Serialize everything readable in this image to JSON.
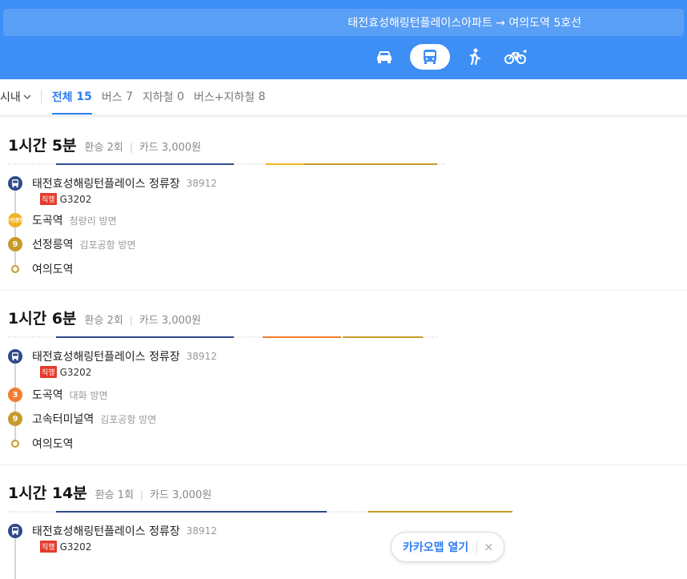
{
  "header": {
    "route_text": "태전효성해링턴플레이스아파트 → 여의도역 5호선",
    "modes": [
      "car-icon",
      "bus-icon",
      "walk-icon",
      "bike-icon"
    ],
    "active_mode": "bus-icon"
  },
  "tabs": {
    "area": "시내",
    "items": [
      {
        "label": "전체",
        "count": "15",
        "active": true
      },
      {
        "label": "버스",
        "count": "7",
        "active": false
      },
      {
        "label": "지하철",
        "count": "0",
        "active": false
      },
      {
        "label": "버스+지하철",
        "count": "8",
        "active": false
      }
    ]
  },
  "routes": [
    {
      "time_hour": "1시간",
      "time_min": "5분",
      "transfer": "환승 2회",
      "fare": "카드 3,000원",
      "stops": [
        {
          "name": "태전효성해링턴플레이스 정류장",
          "sub": "38912",
          "badge": "bus",
          "badge_color": "#2f4a8c"
        },
        {
          "name": "도곡역",
          "sub": "청량리 방면",
          "badge": "수인분당",
          "badge_color": "#f0b324"
        },
        {
          "name": "선정릉역",
          "sub": "김포공항 방면",
          "badge": "9",
          "badge_color": "#c89a2b"
        },
        {
          "name": "여의도역",
          "sub": "",
          "badge": "dot",
          "badge_color": "#c89a2b"
        }
      ],
      "bus_tag": "직행",
      "bus_number": "G3202"
    },
    {
      "time_hour": "1시간",
      "time_min": "6분",
      "transfer": "환승 2회",
      "fare": "카드 3,000원",
      "stops": [
        {
          "name": "태전효성해링턴플레이스 정류장",
          "sub": "38912",
          "badge": "bus",
          "badge_color": "#2f4a8c"
        },
        {
          "name": "도곡역",
          "sub": "대화 방면",
          "badge": "3",
          "badge_color": "#f47d30"
        },
        {
          "name": "고속터미널역",
          "sub": "김포공항 방면",
          "badge": "9",
          "badge_color": "#c89a2b"
        },
        {
          "name": "여의도역",
          "sub": "",
          "badge": "dot",
          "badge_color": "#c89a2b"
        }
      ],
      "bus_tag": "직행",
      "bus_number": "G3202"
    },
    {
      "time_hour": "1시간",
      "time_min": "14분",
      "transfer": "환승 1회",
      "fare": "카드 3,000원",
      "stops": [
        {
          "name": "태전효성해링턴플레이스 정류장",
          "sub": "38912",
          "badge": "bus",
          "badge_color": "#2f4a8c"
        }
      ],
      "bus_tag": "직행",
      "bus_number": "G3202"
    }
  ],
  "open_app": {
    "label": "카카오맵 열기",
    "close": "×"
  },
  "colors": {
    "header_bg": "#3d8ef5",
    "accent": "#2d7df2",
    "bus": "#2f4a8c",
    "line9": "#c89a2b",
    "line3": "#f47d30",
    "suin": "#f0b324"
  }
}
